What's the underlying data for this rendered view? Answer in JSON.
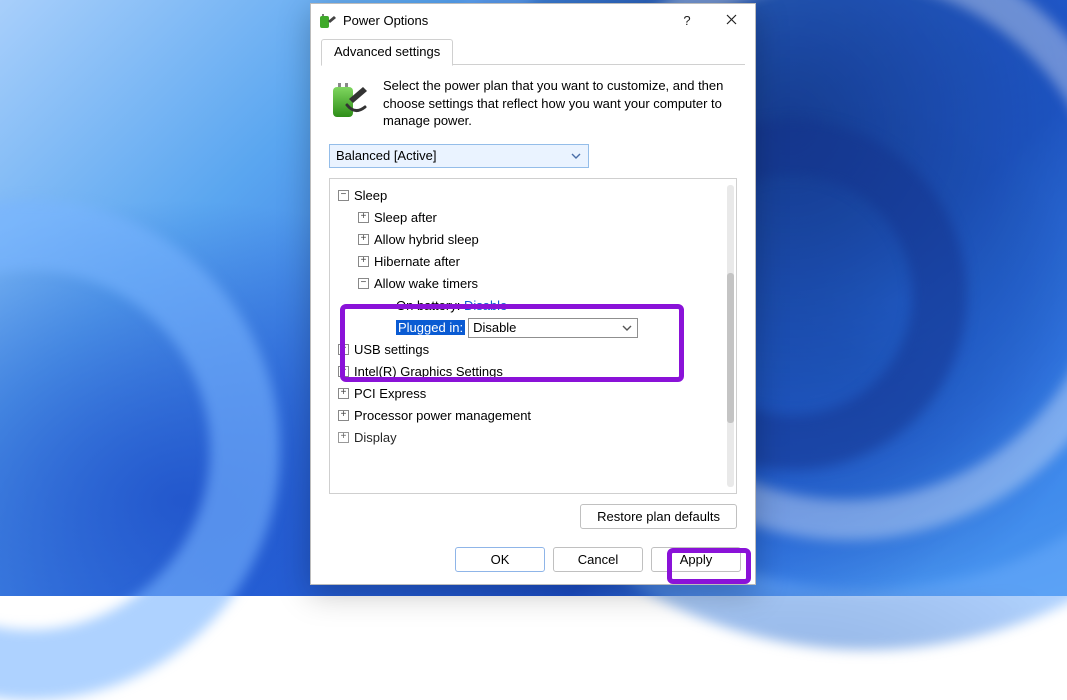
{
  "window": {
    "title": "Power Options",
    "help_label": "?",
    "tab": "Advanced settings",
    "description": "Select the power plan that you want to customize, and then choose settings that reflect how you want your computer to manage power.",
    "plan_selected": "Balanced [Active]"
  },
  "tree": {
    "sleep": "Sleep",
    "sleep_after": "Sleep after",
    "allow_hybrid": "Allow hybrid sleep",
    "hibernate_after": "Hibernate after",
    "allow_wake": "Allow wake timers",
    "on_battery_label": "On battery:",
    "on_battery_val": "Disable",
    "plugged_in_label": "Plugged in:",
    "plugged_in_val": "Disable",
    "usb": "USB settings",
    "intel": "Intel(R) Graphics Settings",
    "pci": "PCI Express",
    "proc": "Processor power management",
    "display": "Display"
  },
  "buttons": {
    "restore": "Restore plan defaults",
    "ok": "OK",
    "cancel": "Cancel",
    "apply": "Apply"
  }
}
